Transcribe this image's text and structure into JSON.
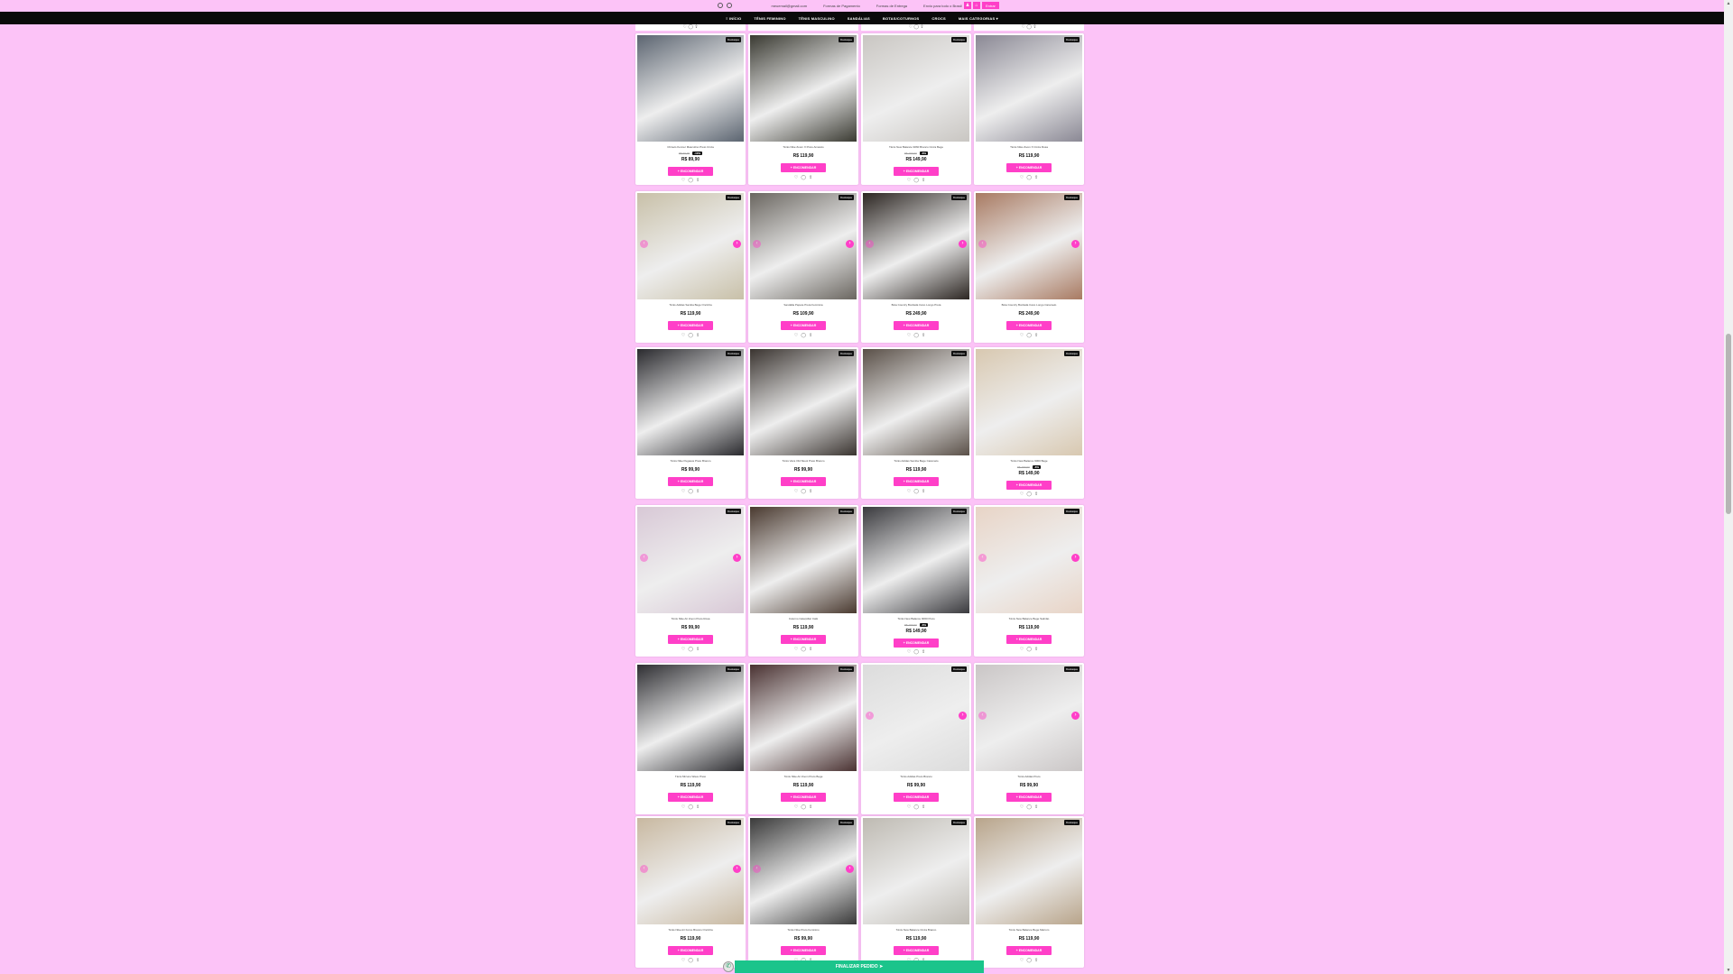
{
  "topbar": {
    "items": [
      "meuemail@gmail.com",
      "Formas de Pagamento",
      "Formas de Entrega",
      "Envio para todo o Brasil"
    ],
    "entrar_label": "Entrar"
  },
  "nav": {
    "items": [
      "≡ INÍCIO",
      "TÊNIS FEMININO",
      "TÊNIS MASCULINO",
      "SANDÁLIAS",
      "BOTAS/COTURNOS",
      "CROCS",
      "MAIS CATEGORIAS ▾"
    ]
  },
  "products": [
    {
      "name": "Chinelo Kenner Masculino Preto Cinza",
      "old": "R$ 99,90",
      "off": "-10%",
      "price": "R$ 89,90",
      "btn": "+ ENCOMENDAR",
      "color": "#5b6470"
    },
    {
      "name": "Tênis Nike Zoom X Preto Amarelo",
      "old": "",
      "off": "",
      "price": "R$ 119,90",
      "btn": "+ ENCOMENDAR",
      "color": "#3a3a32"
    },
    {
      "name": "Tênis New Balance 9060 Branco Cinza Bege",
      "old": "R$ 159,90",
      "off": "-6%",
      "price": "R$ 149,90",
      "btn": "+ ENCOMENDAR",
      "color": "#c9c6c2"
    },
    {
      "name": "Tênis Nike Zoom X Cinza Rosa",
      "old": "",
      "off": "",
      "price": "R$ 119,90",
      "btn": "+ ENCOMENDAR",
      "color": "#8a8894"
    },
    {
      "name": "Tênis Adidas Samba Bege Oncinha",
      "old": "",
      "off": "",
      "price": "R$ 119,90",
      "btn": "+ ENCOMENDAR",
      "color": "#c8c0a8"
    },
    {
      "name": "Sandália Papete Preta Feminina",
      "old": "",
      "off": "",
      "price": "R$ 109,90",
      "btn": "+ ENCOMENDAR",
      "color": "#6a6660"
    },
    {
      "name": "Bota Country Bordada Cano Longo Preta",
      "old": "",
      "off": "",
      "price": "R$ 249,90",
      "btn": "+ ENCOMENDAR",
      "color": "#2c2622"
    },
    {
      "name": "Bota Country Bordada Cano Longo Caramelo",
      "old": "",
      "off": "",
      "price": "R$ 249,90",
      "btn": "+ ENCOMENDAR",
      "color": "#a87a62"
    },
    {
      "name": "Tênis Nike Pegasus Preto Branco",
      "old": "",
      "off": "",
      "price": "R$ 99,90",
      "btn": "+ ENCOMENDAR",
      "color": "#2a2a2e"
    },
    {
      "name": "Tênis Vans Old Skool Preto Branco",
      "old": "",
      "off": "",
      "price": "R$ 99,90",
      "btn": "+ ENCOMENDAR",
      "color": "#3a3430"
    },
    {
      "name": "Tênis Adidas Samba Bege Caramelo",
      "old": "",
      "off": "",
      "price": "R$ 119,90",
      "btn": "+ ENCOMENDAR",
      "color": "#5a5048"
    },
    {
      "name": "Tênis New Balance 9060 Bege",
      "old": "R$ 159,90",
      "off": "-6%",
      "price": "R$ 149,90",
      "btn": "+ ENCOMENDAR",
      "color": "#d8c8b0"
    },
    {
      "name": "Tênis Nike Air Zoom Preto Rosa",
      "old": "",
      "off": "",
      "price": "R$ 99,90",
      "btn": "+ ENCOMENDAR",
      "color": "#d8c8d6"
    },
    {
      "name": "Coturno Caterpillar Café",
      "old": "",
      "off": "",
      "price": "R$ 119,90",
      "btn": "+ ENCOMENDAR",
      "color": "#4a3a30"
    },
    {
      "name": "Tênis New Balance 9060 Preto",
      "old": "R$ 159,90",
      "off": "-6%",
      "price": "R$ 149,90",
      "btn": "+ ENCOMENDAR",
      "color": "#3a3a3e"
    },
    {
      "name": "Tênis New Balance Bege Salmão",
      "old": "",
      "off": "",
      "price": "R$ 119,90",
      "btn": "+ ENCOMENDAR",
      "color": "#e8d4c6"
    },
    {
      "name": "Tênis Mizuno Wave Preto",
      "old": "",
      "off": "",
      "price": "R$ 119,90",
      "btn": "+ ENCOMENDAR",
      "color": "#2e2e32"
    },
    {
      "name": "Tênis Nike Air Zoom Preto Bege",
      "old": "",
      "off": "",
      "price": "R$ 119,90",
      "btn": "+ ENCOMENDAR",
      "color": "#4a3232"
    },
    {
      "name": "Tênis Adidas Preto Branco",
      "old": "",
      "off": "",
      "price": "R$ 99,90",
      "btn": "+ ENCOMENDAR",
      "color": "#dcdcdc"
    },
    {
      "name": "Tênis Adidas Preto",
      "old": "",
      "off": "",
      "price": "R$ 99,90",
      "btn": "+ ENCOMENDAR",
      "color": "#cac6c6"
    },
    {
      "name": "Tênis Nike Air Force Branco Oncinha",
      "old": "",
      "off": "",
      "price": "R$ 119,90",
      "btn": "+ ENCOMENDAR",
      "color": "#c8b8a0"
    },
    {
      "name": "Tênis Nike Preto Feminino",
      "old": "",
      "off": "",
      "price": "R$ 99,90",
      "btn": "+ ENCOMENDAR",
      "color": "#3a3a3a"
    },
    {
      "name": "Tênis New Balance Cinza Branco",
      "old": "",
      "off": "",
      "price": "R$ 119,90",
      "btn": "+ ENCOMENDAR",
      "color": "#bebab2"
    },
    {
      "name": "Tênis New Balance Bege Marrom",
      "old": "",
      "off": "",
      "price": "R$ 119,90",
      "btn": "+ ENCOMENDAR",
      "color": "#b8a48a"
    }
  ],
  "footer": {
    "label": "FINALIZAR PEDIDO ➤"
  }
}
